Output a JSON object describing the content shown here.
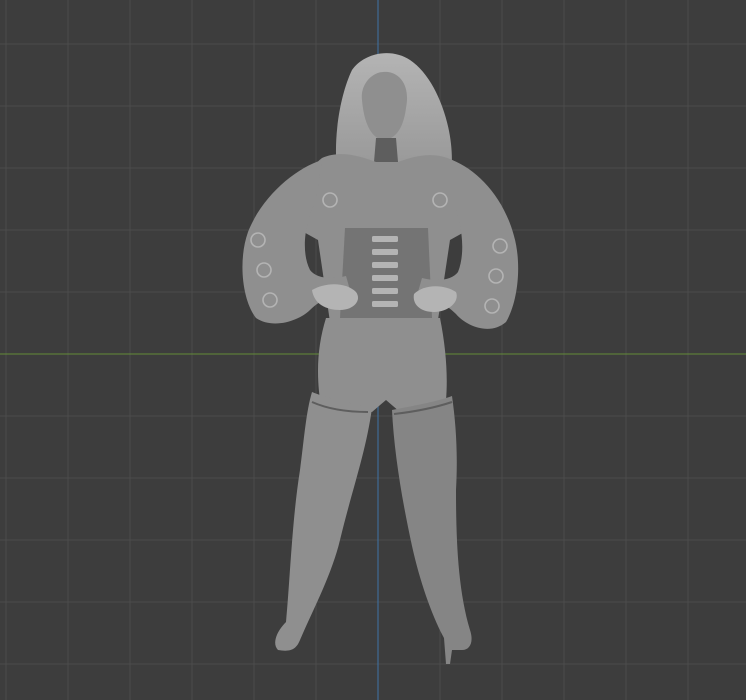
{
  "viewport": {
    "name": "3D Viewport",
    "colors": {
      "background": "#3d3d3d",
      "grid_line": "#4c4c4c",
      "x_axis": "#5c7d3a",
      "z_axis": "#3f6b96",
      "model_base": "#8f8f8f",
      "model_light": "#b4b4b4",
      "model_shadow": "#5e5e5e"
    },
    "object": {
      "semantic": "sculpted-female-figure",
      "shading": "solid"
    }
  }
}
